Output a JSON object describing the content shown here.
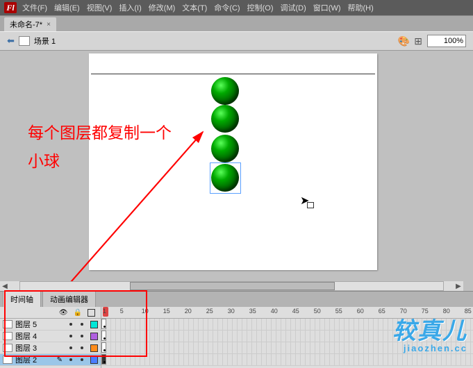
{
  "app_initial": "Fl",
  "menu": [
    "文件(F)",
    "编辑(E)",
    "视图(V)",
    "插入(I)",
    "修改(M)",
    "文本(T)",
    "命令(C)",
    "控制(O)",
    "调试(D)",
    "窗口(W)",
    "帮助(H)"
  ],
  "doc_tab": "未命名-7*",
  "scene_label": "场景 1",
  "zoom": "100%",
  "annotation_line1": "每个图层都复制一个",
  "annotation_line2": "小球",
  "panel_tabs": [
    "时间轴",
    "动画编辑器"
  ],
  "layers": [
    {
      "name": "图层 5",
      "color": "#00e7d8",
      "sel": false
    },
    {
      "name": "图层 4",
      "color": "#b060e0",
      "sel": false
    },
    {
      "name": "图层 3",
      "color": "#ff8c1a",
      "sel": false
    },
    {
      "name": "图层 2",
      "color": "#4a7dff",
      "sel": true
    }
  ],
  "ruler_ticks": [
    1,
    5,
    10,
    15,
    20,
    25,
    30,
    35,
    40,
    45,
    50,
    55,
    60,
    65,
    70,
    75,
    80,
    85
  ],
  "watermark_big": "较真儿",
  "watermark_small": "jiaozhen.cc",
  "chart_data": {
    "type": "other",
    "description": "Flash stage showing four stacked green spheres; timeline shows playhead at frame 1 with 4 layers each having one keyframe at frame 1. Red annotation instructs copying a small ball for each layer.",
    "frames": {
      "playhead": 1,
      "visible_range": [
        1,
        85
      ]
    },
    "objects": [
      {
        "kind": "sphere",
        "color": "green",
        "count": 4,
        "arrangement": "vertical stack"
      }
    ]
  }
}
